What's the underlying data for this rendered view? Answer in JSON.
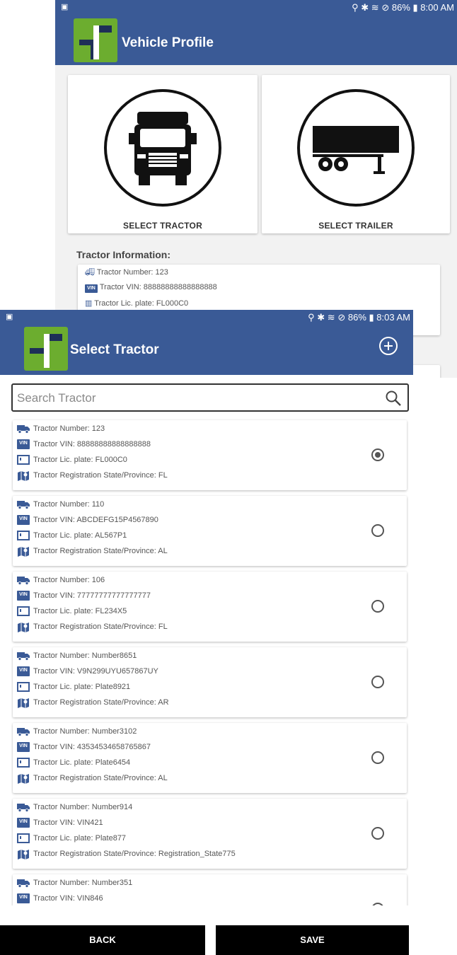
{
  "back_screen": {
    "status_bar": {
      "battery": "86%",
      "time": "8:00 AM"
    },
    "title": "Vehicle Profile",
    "tractor_button_label": "SELECT TRACTOR",
    "trailer_button_label": "SELECT TRAILER",
    "info_heading": "Tractor Information:",
    "info_rows": [
      "Tractor Number: 123",
      "Tractor VIN: 88888888888888888",
      "Tractor Lic. plate: FL000C0"
    ]
  },
  "front_screen": {
    "status_bar": {
      "battery": "86%",
      "time": "8:03 AM"
    },
    "title": "Select Tractor",
    "add_icon": "plus-circle-icon",
    "search": {
      "placeholder": "Search Tractor",
      "value": ""
    },
    "tractors": [
      {
        "number": "Tractor Number: 123",
        "vin": "Tractor VIN: 88888888888888888",
        "plate": "Tractor Lic. plate: FL000C0",
        "state": "Tractor Registration State/Province: FL",
        "selected": true
      },
      {
        "number": "Tractor Number: 110",
        "vin": "Tractor VIN: ABCDEFG15P4567890",
        "plate": "Tractor Lic. plate: AL567P1",
        "state": "Tractor Registration State/Province: AL",
        "selected": false
      },
      {
        "number": "Tractor Number: 106",
        "vin": "Tractor VIN: 77777777777777777",
        "plate": "Tractor Lic. plate: FL234X5",
        "state": "Tractor Registration State/Province: FL",
        "selected": false
      },
      {
        "number": "Tractor Number: Number8651",
        "vin": "Tractor VIN: V9N299UYU657867UY",
        "plate": "Tractor Lic. plate: Plate8921",
        "state": "Tractor Registration State/Province: AR",
        "selected": false
      },
      {
        "number": "Tractor Number: Number3102",
        "vin": "Tractor VIN: 43534534658765867",
        "plate": "Tractor Lic. plate: Plate6454",
        "state": "Tractor Registration State/Province: AL",
        "selected": false
      },
      {
        "number": "Tractor Number: Number914",
        "vin": "Tractor VIN: VIN421",
        "plate": "Tractor Lic. plate: Plate877",
        "state": "Tractor Registration State/Province: Registration_State775",
        "selected": false
      },
      {
        "number": "Tractor Number: Number351",
        "vin": "Tractor VIN: VIN846",
        "plate": "",
        "state": "",
        "selected": false
      }
    ],
    "back_label": "BACK",
    "save_label": "SAVE",
    "vin_badge_text": "VIN"
  },
  "colors": {
    "app_bar": "#3a5a96",
    "logo_green": "#6cad2f",
    "logo_navy": "#1e2f57",
    "button_bg": "#000000"
  }
}
